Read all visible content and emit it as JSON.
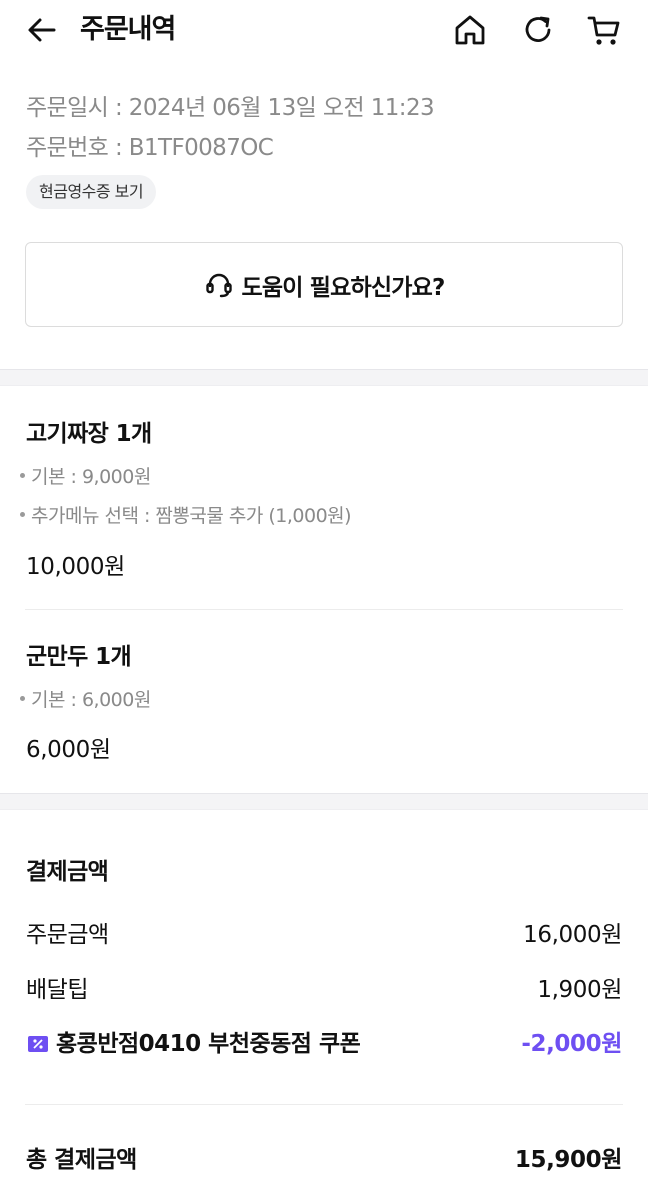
{
  "header": {
    "title": "주문내역",
    "icons": [
      "back-arrow-icon",
      "home-icon",
      "refresh-icon",
      "cart-icon"
    ]
  },
  "order": {
    "date_line": "주문일시 : 2024년 06월 13일 오전 11:23",
    "number_line": "주문번호 : B1TF0087OC",
    "receipt_label": "현금영수증 보기"
  },
  "help": {
    "label": "도움이 필요하신가요?",
    "icon": "headset-icon"
  },
  "items": [
    {
      "name": "고기짜장 1개",
      "options": [
        "기본 : 9,000원",
        "추가메뉴 선택 : 짬뽕국물 추가 (1,000원)"
      ],
      "price": "10,000원"
    },
    {
      "name": "군만두 1개",
      "options": [
        "기본 : 6,000원"
      ],
      "price": "6,000원"
    }
  ],
  "payment": {
    "title": "결제금액",
    "order_amount_label": "주문금액",
    "order_amount": "16,000원",
    "delivery_tip_label": "배달팁",
    "delivery_tip": "1,900원",
    "coupon_label": "홍콩반점0410 부천중동점 쿠폰",
    "coupon_amount": "-2,000원",
    "total_label": "총 결제금액",
    "total": "15,900원"
  },
  "colors": {
    "accent": "#6e4ff2",
    "muted_text": "#8a8a8a",
    "divider_bg": "#f4f4f6"
  }
}
